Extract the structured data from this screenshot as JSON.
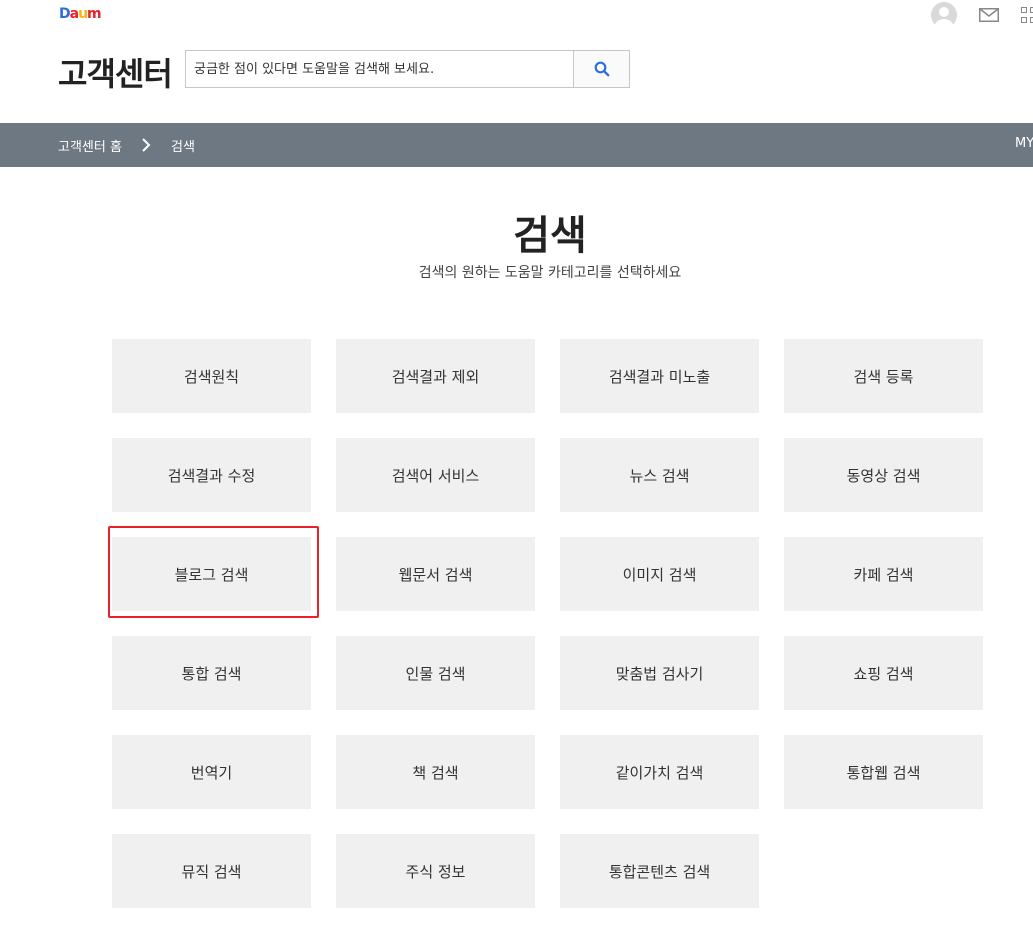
{
  "header": {
    "logo_letters": [
      {
        "char": "D",
        "color": "#2b6fde"
      },
      {
        "char": "a",
        "color": "#e8212b"
      },
      {
        "char": "u",
        "color": "#f6b60d"
      },
      {
        "char": "m",
        "color": "#e8212b"
      }
    ],
    "brand_title": "고객센터",
    "search_placeholder": "궁금한 점이 있다면 도움말을 검색해 보세요.",
    "icons": [
      "avatar-icon",
      "mail-icon",
      "apps-grid-icon"
    ]
  },
  "breadcrumb": {
    "home": "고객센터 홈",
    "current": "검색",
    "right_link": "MY"
  },
  "main": {
    "title": "검색",
    "subtitle": "검색의 원하는 도움말 카테고리를 선택하세요",
    "categories": [
      "검색원칙",
      "검색결과 제외",
      "검색결과 미노출",
      "검색 등록",
      "검색결과 수정",
      "검색어 서비스",
      "뉴스 검색",
      "동영상 검색",
      "블로그 검색",
      "웹문서 검색",
      "이미지 검색",
      "카페 검색",
      "통합 검색",
      "인물 검색",
      "맞춤법 검사기",
      "쇼핑 검색",
      "번역기",
      "책 검색",
      "같이가치 검색",
      "통합웹 검색",
      "뮤직 검색",
      "주식 정보",
      "통합콘텐츠 검색"
    ],
    "highlighted": "블로그 검색"
  },
  "colors": {
    "navbar": "#6e7883",
    "tile": "#f0f0f0",
    "highlight": "#e8212b",
    "search_icon": "#2b6fde"
  }
}
